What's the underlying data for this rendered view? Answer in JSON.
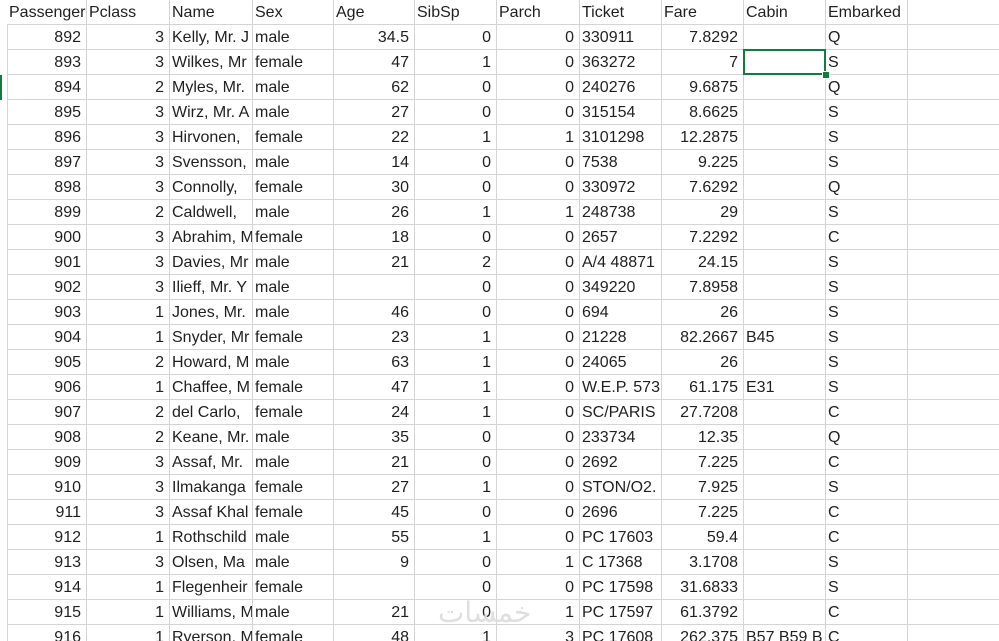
{
  "sheet": {
    "columns": [
      "PassengerId",
      "Pclass",
      "Name",
      "Sex",
      "Age",
      "SibSp",
      "Parch",
      "Ticket",
      "Fare",
      "Cabin",
      "Embarked"
    ],
    "header_display": [
      "Passenger",
      "Pclass",
      "Name",
      "Sex",
      "Age",
      "SibSp",
      "Parch",
      "Ticket",
      "Fare",
      "Cabin",
      "Embarked"
    ],
    "rows": [
      [
        "892",
        "3",
        "Kelly, Mr. J",
        "male",
        "34.5",
        "0",
        "0",
        "330911",
        "7.8292",
        "",
        "Q"
      ],
      [
        "893",
        "3",
        "Wilkes, Mr",
        "female",
        "47",
        "1",
        "0",
        "363272",
        "7",
        "",
        "S"
      ],
      [
        "894",
        "2",
        "Myles, Mr.",
        "male",
        "62",
        "0",
        "0",
        "240276",
        "9.6875",
        "",
        "Q"
      ],
      [
        "895",
        "3",
        "Wirz, Mr. A",
        "male",
        "27",
        "0",
        "0",
        "315154",
        "8.6625",
        "",
        "S"
      ],
      [
        "896",
        "3",
        "Hirvonen,",
        "female",
        "22",
        "1",
        "1",
        "3101298",
        "12.2875",
        "",
        "S"
      ],
      [
        "897",
        "3",
        "Svensson,",
        "male",
        "14",
        "0",
        "0",
        "7538",
        "9.225",
        "",
        "S"
      ],
      [
        "898",
        "3",
        "Connolly,",
        "female",
        "30",
        "0",
        "0",
        "330972",
        "7.6292",
        "",
        "Q"
      ],
      [
        "899",
        "2",
        "Caldwell,",
        "male",
        "26",
        "1",
        "1",
        "248738",
        "29",
        "",
        "S"
      ],
      [
        "900",
        "3",
        "Abrahim, M",
        "female",
        "18",
        "0",
        "0",
        "2657",
        "7.2292",
        "",
        "C"
      ],
      [
        "901",
        "3",
        "Davies, Mr",
        "male",
        "21",
        "2",
        "0",
        "A/4 48871",
        "24.15",
        "",
        "S"
      ],
      [
        "902",
        "3",
        "Ilieff, Mr. Y",
        "male",
        "",
        "0",
        "0",
        "349220",
        "7.8958",
        "",
        "S"
      ],
      [
        "903",
        "1",
        "Jones, Mr.",
        "male",
        "46",
        "0",
        "0",
        "694",
        "26",
        "",
        "S"
      ],
      [
        "904",
        "1",
        "Snyder, Mr",
        "female",
        "23",
        "1",
        "0",
        "21228",
        "82.2667",
        "B45",
        "S"
      ],
      [
        "905",
        "2",
        "Howard, M",
        "male",
        "63",
        "1",
        "0",
        "24065",
        "26",
        "",
        "S"
      ],
      [
        "906",
        "1",
        "Chaffee, M",
        "female",
        "47",
        "1",
        "0",
        "W.E.P. 573",
        "61.175",
        "E31",
        "S"
      ],
      [
        "907",
        "2",
        "del Carlo,",
        "female",
        "24",
        "1",
        "0",
        "SC/PARIS",
        "27.7208",
        "",
        "C"
      ],
      [
        "908",
        "2",
        "Keane, Mr.",
        "male",
        "35",
        "0",
        "0",
        "233734",
        "12.35",
        "",
        "Q"
      ],
      [
        "909",
        "3",
        "Assaf, Mr.",
        "male",
        "21",
        "0",
        "0",
        "2692",
        "7.225",
        "",
        "C"
      ],
      [
        "910",
        "3",
        "Ilmakanga",
        "female",
        "27",
        "1",
        "0",
        "STON/O2.",
        "7.925",
        "",
        "S"
      ],
      [
        "911",
        "3",
        "Assaf Khal",
        "female",
        "45",
        "0",
        "0",
        "2696",
        "7.225",
        "",
        "C"
      ],
      [
        "912",
        "1",
        "Rothschild",
        "male",
        "55",
        "1",
        "0",
        "PC 17603",
        "59.4",
        "",
        "C"
      ],
      [
        "913",
        "3",
        "Olsen, Ma",
        "male",
        "9",
        "0",
        "1",
        "C 17368",
        "3.1708",
        "",
        "S"
      ],
      [
        "914",
        "1",
        "Flegenheir",
        "female",
        "",
        "0",
        "0",
        "PC 17598",
        "31.6833",
        "",
        "S"
      ],
      [
        "915",
        "1",
        "Williams, M",
        "male",
        "21",
        "0",
        "1",
        "PC 17597",
        "61.3792",
        "",
        "C"
      ],
      [
        "916",
        "1",
        "Ryerson, M",
        "female",
        "48",
        "1",
        "3",
        "PC 17608",
        "262.375",
        "B57 B59 B",
        "C"
      ]
    ],
    "numeric_columns": [
      0,
      1,
      4,
      5,
      6,
      8
    ],
    "selected_cell": {
      "row": 1,
      "col": 9
    },
    "accent_color": "#107c41",
    "gridline_color": "#d4d4d4"
  },
  "watermark": {
    "text": "خمسات"
  }
}
